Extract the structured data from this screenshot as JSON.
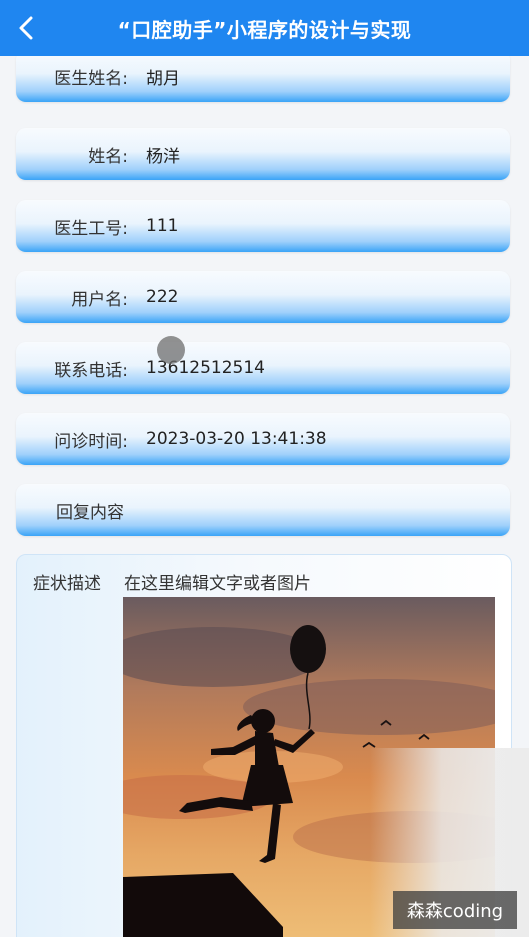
{
  "navbar": {
    "title": "“口腔助手”小程序的设计与实现",
    "back_icon": "chevron-left-icon"
  },
  "fields": {
    "doctor_name": {
      "label": "医生姓名:",
      "value": "胡月"
    },
    "name": {
      "label": "姓名:",
      "value": "杨洋"
    },
    "doctor_id": {
      "label": "医生工号:",
      "value": "111"
    },
    "username": {
      "label": "用户名:",
      "value": "222"
    },
    "phone": {
      "label": "联系电话:",
      "value": "13612512514"
    },
    "consult_time": {
      "label": "问诊时间:",
      "value": "2023-03-20 13:41:38"
    },
    "reply": {
      "label": "回复内容"
    }
  },
  "symptoms": {
    "label": "症状描述",
    "placeholder": "在这里编辑文字或者图片"
  },
  "watermark": {
    "text": "森森coding"
  },
  "colors": {
    "primary": "#1f86f0",
    "field_gradient_end": "#3aa4f7"
  }
}
